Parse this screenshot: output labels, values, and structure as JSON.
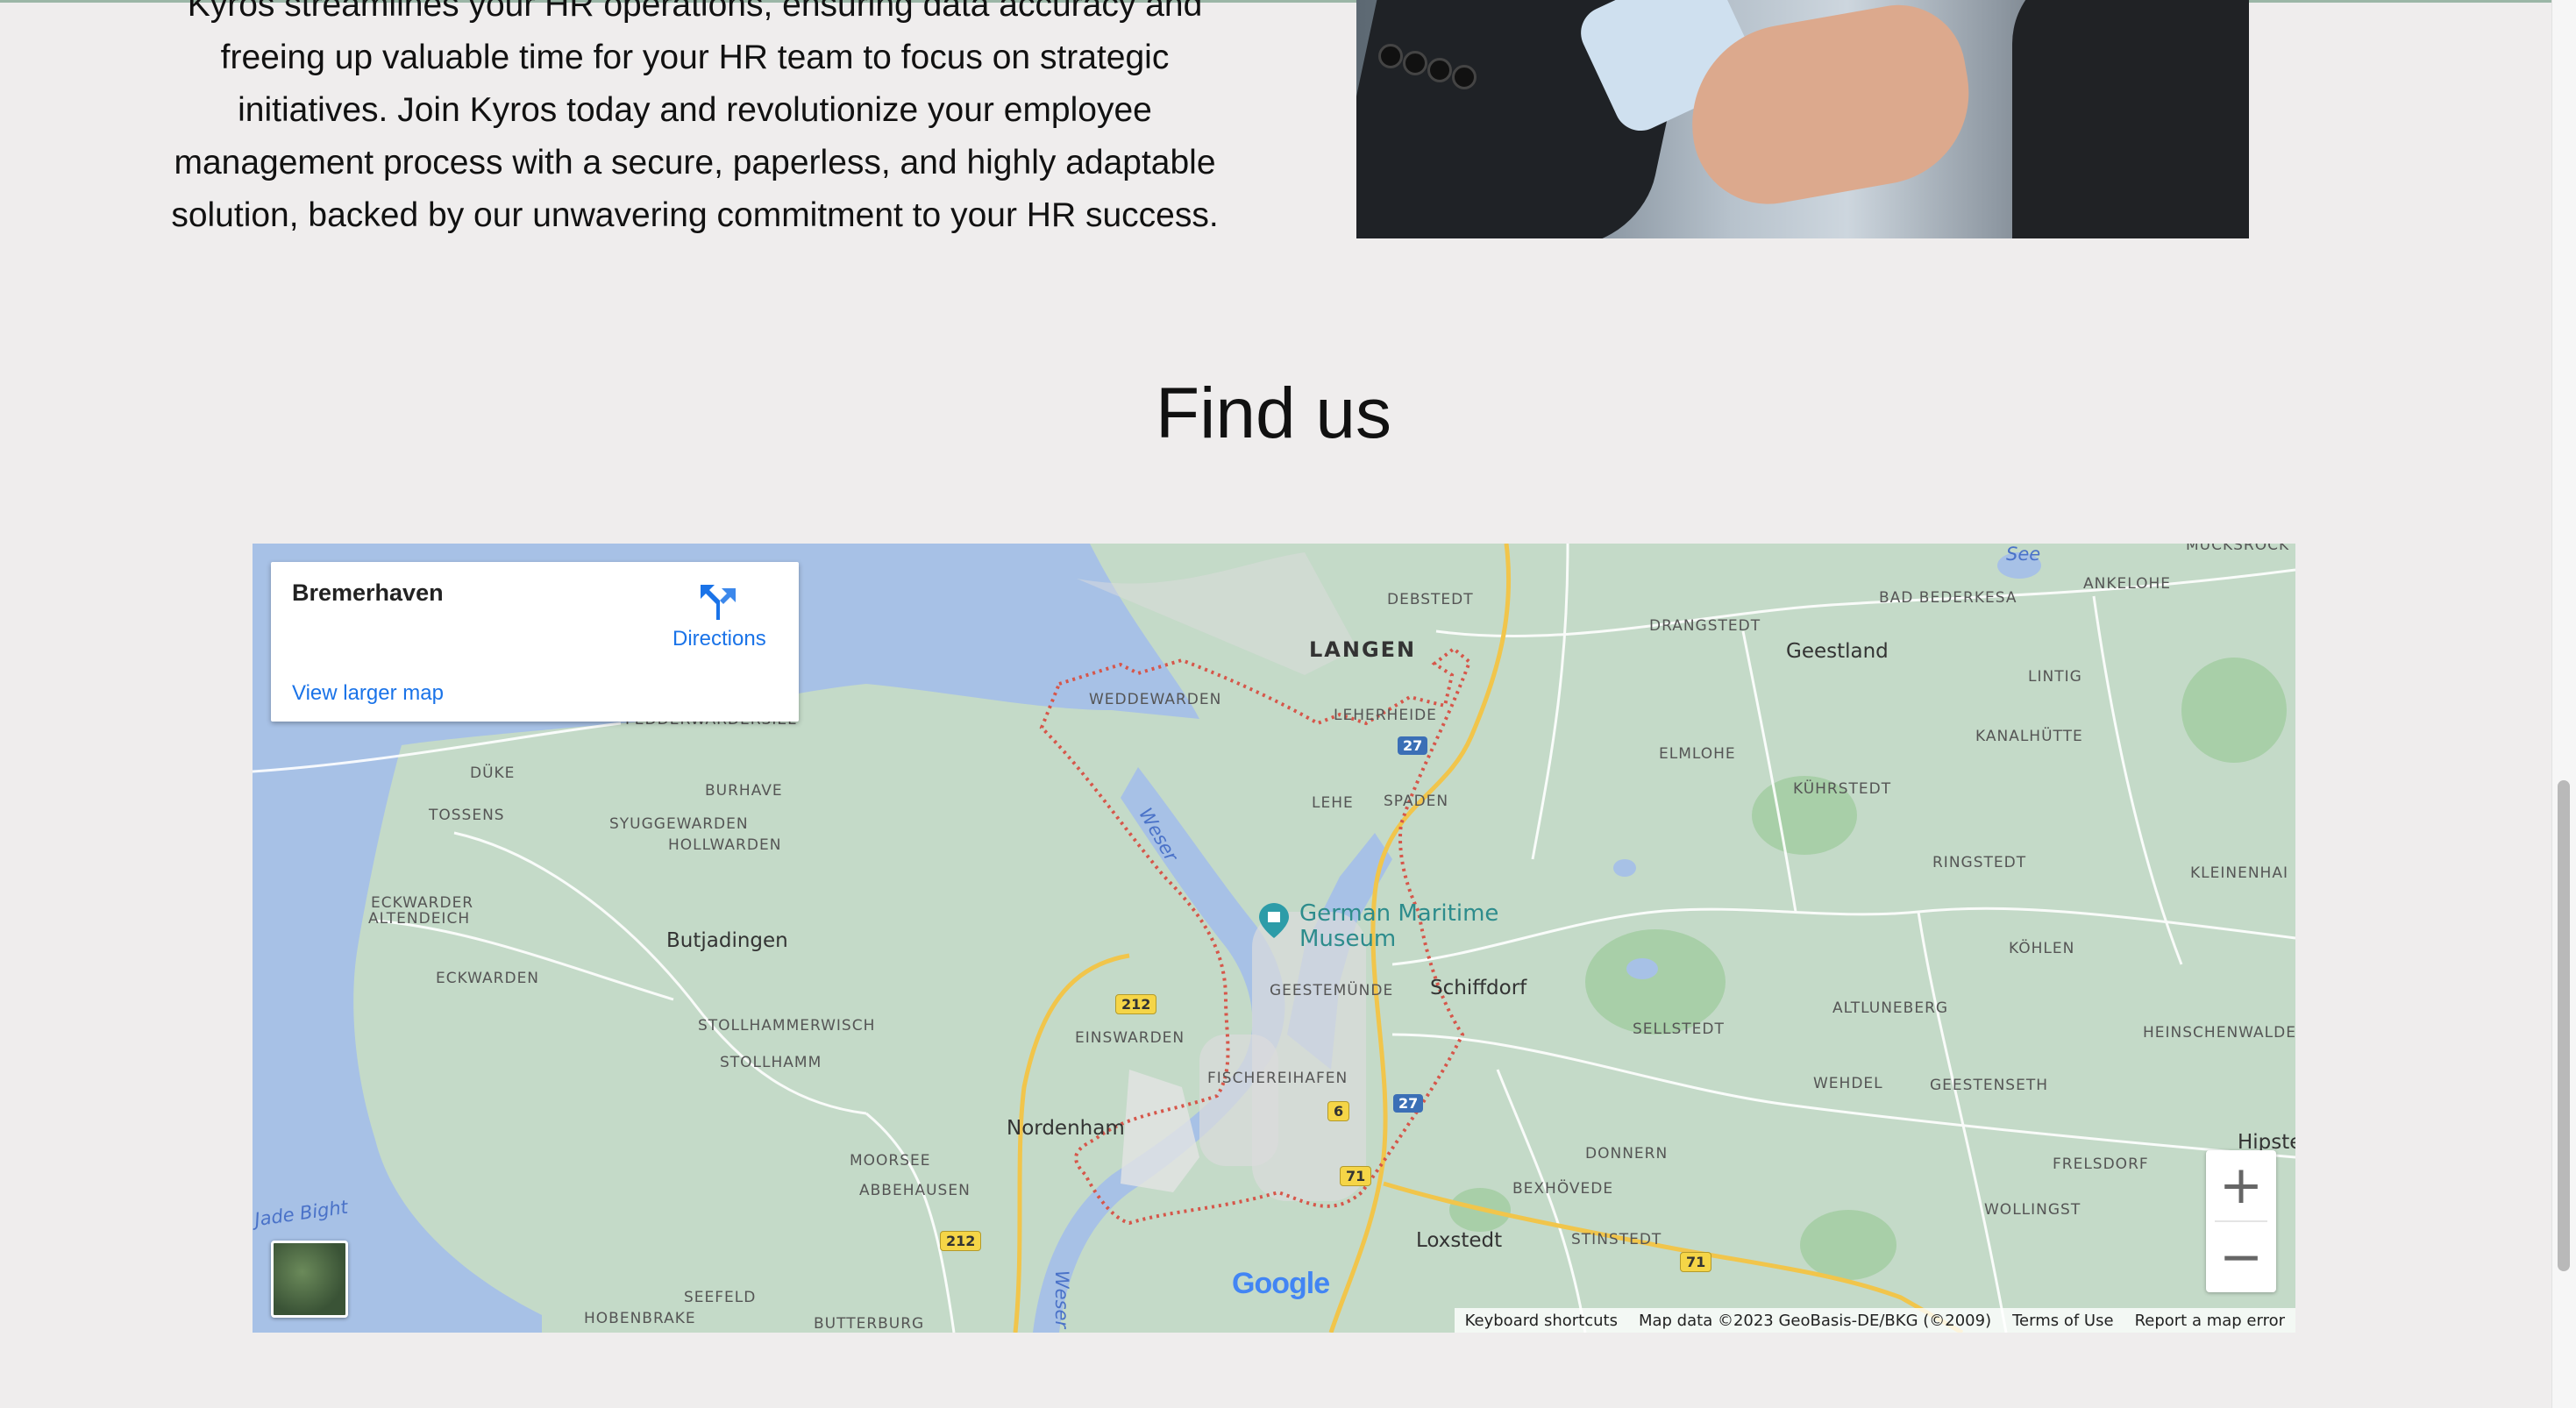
{
  "about": {
    "lines": [
      "Kyros streamlines your HR operations, ensuring data accuracy and",
      "freeing up valuable time for your HR team to focus on strategic",
      "initiatives. Join Kyros today and revolutionize your employee",
      "management process with a secure, paperless, and highly adaptable",
      "solution, backed by our unwavering commitment to your HR success."
    ]
  },
  "section_title": "Find us",
  "map": {
    "place_name": "Bremerhaven",
    "directions_label": "Directions",
    "view_larger_label": "View larger map",
    "zoom_in_label": "+",
    "zoom_out_label": "−",
    "google_logo": "Google",
    "attribution": {
      "keyboard": "Keyboard shortcuts",
      "map_data": "Map data ©2023 GeoBasis-DE/BKG (©2009)",
      "terms": "Terms of Use",
      "report": "Report a map error"
    },
    "labels": {
      "see": "See",
      "ankelohe": "ANKELOHE",
      "debstedt": "DEBSTEDT",
      "langen": "LANGEN",
      "drangstedt": "DRANGSTEDT",
      "geestland": "Geestland",
      "bad_bederkesa": "BAD BEDERKESA",
      "lintig": "LINTIG",
      "weddewarden": "WEDDEWARDEN",
      "leherheide": "LEHERHEIDE",
      "fedderwardersiel": "FEDDERWARDERSIEL",
      "kanalhuette": "KANALHÜTTE",
      "elmlohe": "ELMLOHE",
      "duke": "DÜKE",
      "burhave": "BURHAVE",
      "tossens": "TOSSENS",
      "syuggewarden": "SYUGGEWARDEN",
      "hollwarden": "HOLLWARDEN",
      "lehe": "LEHE",
      "spaden": "SPADEN",
      "kuehrstedt": "KÜHRSTEDT",
      "ringstedt": "RINGSTEDT",
      "kleinenhain": "KLEINENHAI",
      "eckwarder_altendeich_1": "ECKWARDER",
      "eckwarder_altendeich_2": "ALTENDEICH",
      "butjadingen": "Butjadingen",
      "museum_1": "German Maritime",
      "museum_2": "Museum",
      "koehlen": "KÖHLEN",
      "eckwarden": "ECKWARDEN",
      "geestemuende": "GEESTEMÜNDE",
      "schiffdorf": "Schiffdorf",
      "altluneberg": "ALTLUNEBERG",
      "stollhammerwisch": "STOLLHAMMERWISCH",
      "einswarden": "EINSWARDEN",
      "sellstedt": "SELLSTEDT",
      "heinschenwalde": "HEINSCHENWALDE",
      "stollhamm": "STOLLHAMM",
      "fischereihafen": "FISCHEREIHAFEN",
      "wehdel": "WEHDEL",
      "geestenseth": "GEESTENSETH",
      "nordenham": "Nordenham",
      "moorsee": "MOORSEE",
      "donnern": "DONNERN",
      "hipstedt": "Hipste",
      "abbehausen": "ABBEHAUSEN",
      "bexhoevede": "BEXHÖVEDE",
      "frelsdorf": "FRELSDORF",
      "wollingst": "WOLLINGST",
      "jade_bight": "Jade Bight",
      "loxstedt": "Loxstedt",
      "stinstedt": "STINSTEDT",
      "seefeld": "SEEFELD",
      "hobenbrake": "HOBENBRAKE",
      "butterburg": "BUTTERBURG",
      "weser_1": "Weser",
      "weser_2": "Weser",
      "mucksrock": "MUCKSROCK"
    },
    "shields": {
      "a27_1": "27",
      "a27_2": "27",
      "b212_1": "212",
      "b212_2": "212",
      "b6": "6",
      "b71_1": "71",
      "b71_2": "71"
    }
  }
}
